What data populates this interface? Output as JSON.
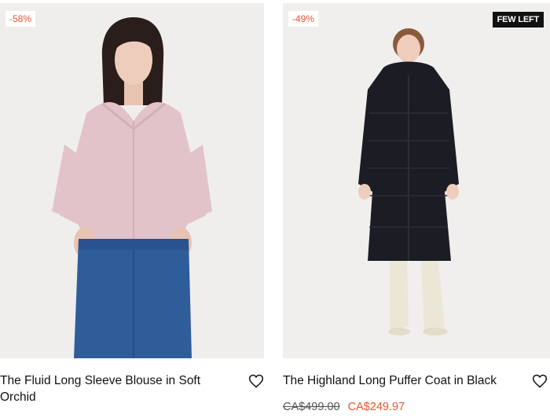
{
  "products": [
    {
      "discount_badge": "-58%",
      "title": "The Fluid Long Sleeve Blouse in Soft Orchid",
      "wishlist_icon": "heart-outline-icon"
    },
    {
      "discount_badge": "-49%",
      "stock_badge": "FEW LEFT",
      "title": "The Highland Long Puffer Coat in Black",
      "price_original": "CA$499.00",
      "price_sale": "CA$249.97",
      "wishlist_icon": "heart-outline-icon"
    }
  ],
  "colors": {
    "sale_accent": "#e8552f",
    "badge_dark": "#111111",
    "photo_bg": "#efeeed"
  }
}
